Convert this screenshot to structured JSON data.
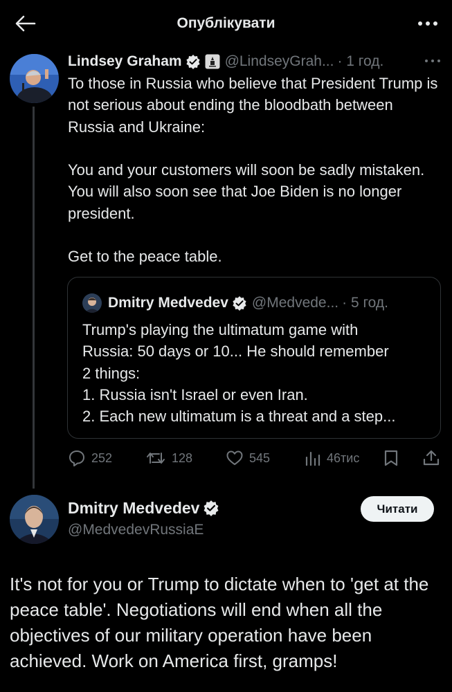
{
  "header": {
    "title": "Опублікувати",
    "back_icon": "arrow-left-icon",
    "more_icon": "more-horizontal-icon"
  },
  "tweet": {
    "name": "Lindsey Graham",
    "handle": "@LindseyGrah...",
    "time": "· 1 год.",
    "paragraphs": [
      "To those in Russia who believe that President Trump is not serious about ending the bloodbath between Russia and Ukraine:",
      "You and your customers will soon be sadly mistaken. You will also soon see that Joe Biden is no longer president.",
      "Get to the peace table."
    ],
    "quote": {
      "name": "Dmitry Medvedev",
      "handle": "@Medvede...",
      "time": "· 5 год.",
      "lines": [
        "Trump's playing the ultimatum game with",
        "Russia: 50 days or 10... He should remember",
        "2 things:",
        "1. Russia isn't Israel or even Iran.",
        "2. Each new ultimatum is a threat and a step..."
      ]
    },
    "stats": {
      "replies": "252",
      "reposts": "128",
      "likes": "545",
      "views": "46тис"
    }
  },
  "reply": {
    "name": "Dmitry Medvedev",
    "handle": "@MedvedevRussiaE",
    "follow_label": "Читати",
    "text": "It's not for you or Trump to dictate when to 'get at the peace table'. Negotiations will end when all the objectives of our military operation have been achieved. Work on America first, gramps!"
  },
  "colors": {
    "background": "#000000",
    "text": "#e7e9ea",
    "muted": "#71767b",
    "verified": "#e7e9ea",
    "divider": "#333639"
  }
}
